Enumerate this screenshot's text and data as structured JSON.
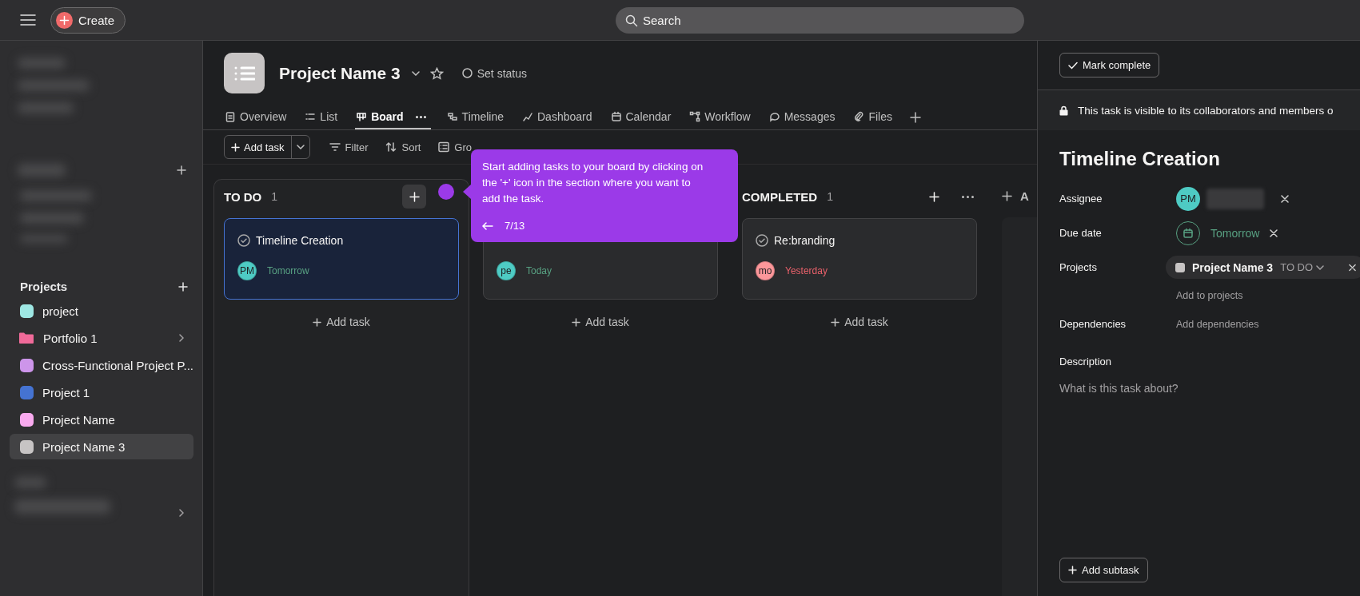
{
  "topbar": {
    "create": "Create",
    "search_placeholder": "Search"
  },
  "sidebar": {
    "projects_heading": "Projects",
    "projects": [
      {
        "name": "project",
        "color": "#9ee7e3",
        "kind": "project",
        "selected": false
      },
      {
        "name": "Portfolio 1",
        "color": "#f06a99",
        "kind": "portfolio",
        "selected": false
      },
      {
        "name": "Cross-Functional Project P...",
        "color": "#cd95ea",
        "kind": "project",
        "selected": false
      },
      {
        "name": "Project 1",
        "color": "#4573d2",
        "kind": "project",
        "selected": false
      },
      {
        "name": "Project Name",
        "color": "#f9aaef",
        "kind": "project",
        "selected": false
      },
      {
        "name": "Project Name 3",
        "color": "#c7c4c4",
        "kind": "project",
        "selected": true
      }
    ]
  },
  "project": {
    "title": "Project Name 3",
    "status": "Set status"
  },
  "tabs": [
    {
      "label": "Overview",
      "selected": false
    },
    {
      "label": "List",
      "selected": false
    },
    {
      "label": "Board",
      "selected": true
    },
    {
      "label": "Timeline",
      "selected": false
    },
    {
      "label": "Dashboard",
      "selected": false
    },
    {
      "label": "Calendar",
      "selected": false
    },
    {
      "label": "Workflow",
      "selected": false
    },
    {
      "label": "Messages",
      "selected": false
    },
    {
      "label": "Files",
      "selected": false
    }
  ],
  "toolbar": {
    "add_task": "Add task",
    "actions": [
      "Filter",
      "Sort",
      "Gro"
    ]
  },
  "columns": [
    {
      "name": "TO DO",
      "count": "1",
      "add_task": "Add task",
      "cards": [
        {
          "title": "Timeline Creation",
          "initials": "PM",
          "color": "#4ecbc4",
          "due": "Tomorrow",
          "overdue": false,
          "selected": true
        }
      ]
    },
    {
      "add_task": "Add task",
      "cards": [
        {
          "initials": "pe",
          "color": "#4ecbc4",
          "due": "Today",
          "overdue": false,
          "selected": false
        }
      ]
    },
    {
      "name": "COMPLETED",
      "count": "1",
      "add_task": "Add task",
      "cards": [
        {
          "title": "Re:branding",
          "initials": "mo",
          "color": "#fc979a",
          "due": "Yesterday",
          "overdue": true,
          "selected": false
        }
      ]
    }
  ],
  "add_section": "A",
  "tooltip": {
    "text": "Start adding tasks to your board by clicking on the '+' icon in the section where you want to add the task.",
    "step": "7/13"
  },
  "task_panel": {
    "mark_complete": "Mark complete",
    "visibility": "This task is visible to its collaborators and members o",
    "title": "Timeline Creation",
    "fields": [
      {
        "label": "Assignee",
        "kind": "assignee",
        "initials": "PM",
        "color": "#4ecbc4"
      },
      {
        "label": "Due date",
        "kind": "date",
        "value": "Tomorrow"
      },
      {
        "label": "Projects",
        "kind": "project",
        "project": "Project Name 3",
        "section": "TO DO",
        "color": "#c7c4c4",
        "action": "Add to projects"
      },
      {
        "label": "Dependencies",
        "kind": "action",
        "action": "Add dependencies"
      }
    ],
    "description_label": "Description",
    "description_placeholder": "What is this task about?",
    "add_subtask": "Add subtask"
  }
}
